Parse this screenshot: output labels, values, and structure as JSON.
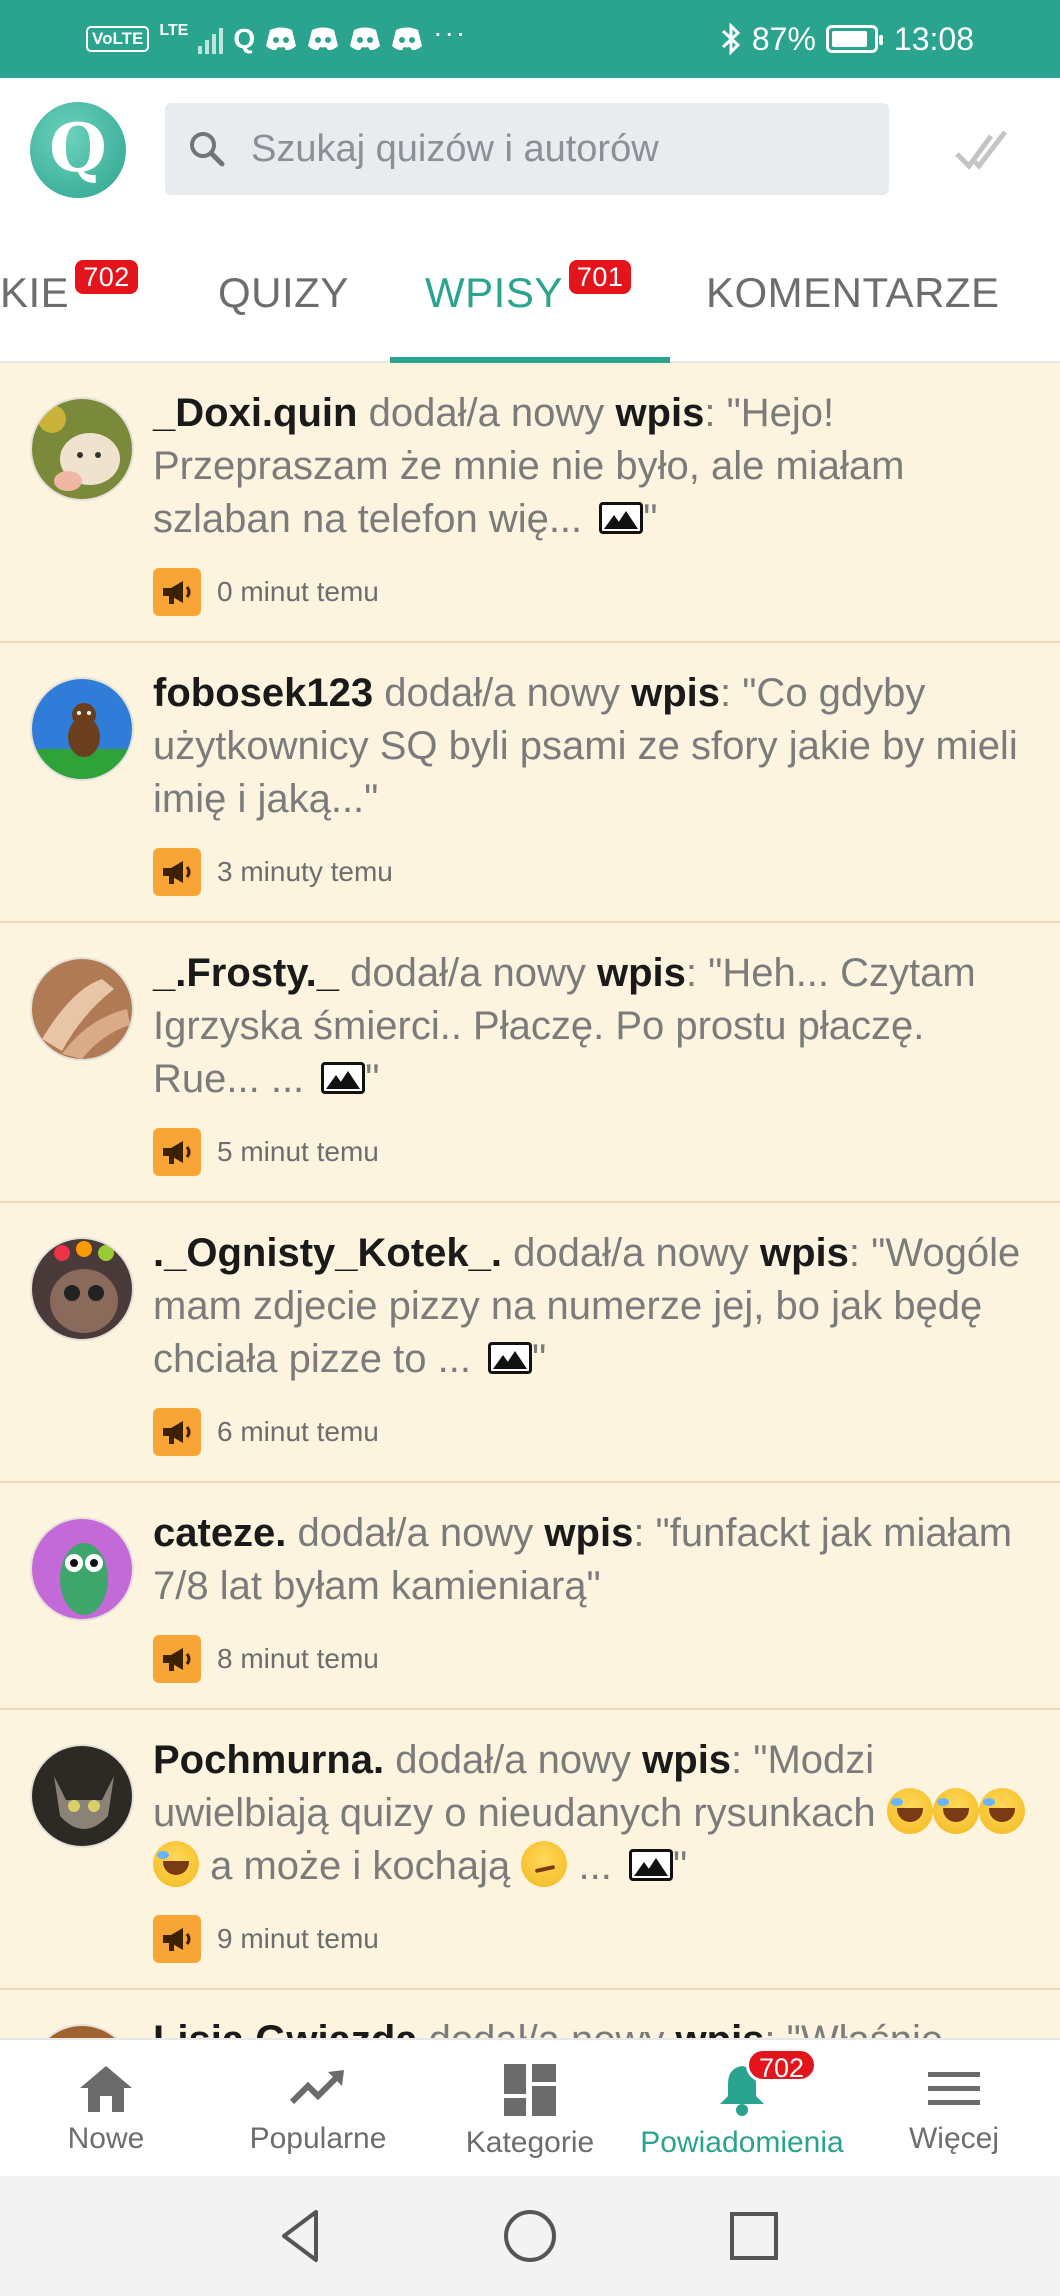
{
  "status_bar": {
    "volte": "VoLTE",
    "network": "LTE",
    "app_glyph": "Q",
    "more": "···",
    "battery": "87%",
    "time": "13:08",
    "battery_level": 0.87
  },
  "header": {
    "logo_letter": "Q",
    "search_placeholder": "Szukaj quizów i autorów"
  },
  "tabs": [
    {
      "label": "KIE",
      "badge": "702"
    },
    {
      "label": "QUIZY",
      "badge": ""
    },
    {
      "label": "WPISY",
      "badge": "701"
    },
    {
      "label": "KOMENTARZE",
      "badge": ""
    }
  ],
  "feed": {
    "action_text": "dodał/a nowy",
    "keyword": "wpis",
    "items": [
      {
        "user": "_Doxi.quin",
        "quote_open": ": \"Hejo! Przepraszam że mnie nie było, ale miałam szlaban na telefon wię... ",
        "quote_close": "\"",
        "time": "0 minut temu"
      },
      {
        "user": "fobosek123",
        "quote_open": ": \"Co gdyby użytkownicy SQ byli psami ze sfory jakie by mieli imię i jaką...\"",
        "quote_close": "",
        "time": "3 minuty temu"
      },
      {
        "user": "_.Frosty._",
        "quote_open": ": \"Heh... Czytam Igrzyska śmierci.. Płaczę. Po prostu płaczę. Rue... ... ",
        "quote_close": "\"",
        "time": "5 minut temu"
      },
      {
        "user": "._Ognisty_Kotek_.",
        "quote_open": ": \"Wogóle mam zdjecie pizzy na numerze jej, bo jak będę chciała pizze to ... ",
        "quote_close": "\"",
        "time": "6 minut temu"
      },
      {
        "user": "cateze.",
        "quote_open": ": \"funfackt jak miałam 7/8 lat byłam kamieniarą\"",
        "quote_close": "",
        "time": "8 minut temu"
      },
      {
        "user": "Pochmurna.",
        "quote_a": ": \"Modzi uwielbiają quizy o nieudanych rysunkach ",
        "quote_b": " a może i kochają ",
        "quote_c": " ... ",
        "quote_close": "\"",
        "time": "9 minut temu"
      },
      {
        "user": "Lisia Gwiazda",
        "quote_open": ": \"Właśnie",
        "quote_close": "",
        "time": ""
      }
    ]
  },
  "bottom_nav": [
    {
      "label": "Nowe",
      "icon": "home-icon"
    },
    {
      "label": "Popularne",
      "icon": "trending-icon"
    },
    {
      "label": "Kategorie",
      "icon": "dashboard-icon"
    },
    {
      "label": "Powiadomienia",
      "icon": "bell-icon",
      "badge": "702"
    },
    {
      "label": "Więcej",
      "icon": "menu-icon"
    }
  ],
  "colors": {
    "accent": "#2aa38f",
    "badge": "#e3141b",
    "feed_bg": "#fdf4e0",
    "megaphone": "#f7a534"
  }
}
